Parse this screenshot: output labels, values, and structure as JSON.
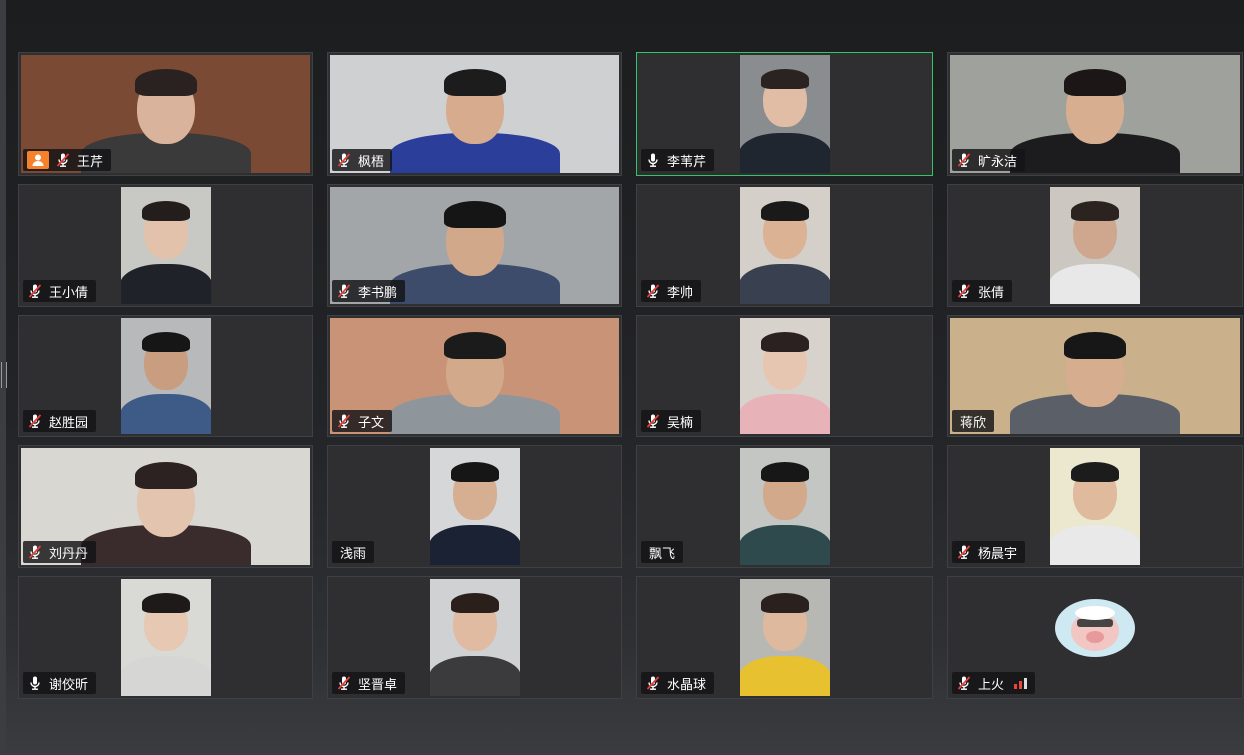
{
  "meeting": {
    "accent_speaking": "#34c56b",
    "host_badge_color": "#f5822a",
    "participants": [
      {
        "name": "王芹",
        "mic": "muted",
        "host": true,
        "speaking": false,
        "video": "full",
        "bg": "#7b4a34",
        "skin": "#d9b39b",
        "hair": "#2a2220",
        "shirt": "#3a3a3a"
      },
      {
        "name": "枫梧",
        "mic": "muted",
        "host": false,
        "speaking": false,
        "video": "full",
        "bg": "#cfd0d2",
        "skin": "#d6ab8e",
        "hair": "#1c1c1c",
        "shirt": "#2b3f9a"
      },
      {
        "name": "李苇芹",
        "mic": "on",
        "host": false,
        "speaking": true,
        "video": "portrait",
        "bg": "#8a8d90",
        "skin": "#e0bda4",
        "hair": "#2a2322",
        "shirt": "#1f2630"
      },
      {
        "name": "旷永洁",
        "mic": "muted",
        "host": false,
        "speaking": false,
        "video": "full",
        "bg": "#9ea19c",
        "skin": "#d7ae90",
        "hair": "#1c1716",
        "shirt": "#1c1c1e"
      },
      {
        "name": "王小倩",
        "mic": "muted",
        "host": false,
        "speaking": false,
        "video": "portrait",
        "bg": "#c8c9c4",
        "skin": "#e2c2ab",
        "hair": "#231d1c",
        "shirt": "#1f2228"
      },
      {
        "name": "李书鹏",
        "mic": "muted",
        "host": false,
        "speaking": false,
        "video": "full",
        "bg": "#a3a6a9",
        "skin": "#d1a88a",
        "hair": "#151515",
        "shirt": "#3c4c6a"
      },
      {
        "name": "李帅",
        "mic": "muted",
        "host": false,
        "speaking": false,
        "video": "portrait",
        "bg": "#d4cfc8",
        "skin": "#dcb295",
        "hair": "#1a1a1a",
        "shirt": "#394150"
      },
      {
        "name": "张倩",
        "mic": "muted",
        "host": false,
        "speaking": false,
        "video": "portrait",
        "bg": "#ccc8c1",
        "skin": "#cfa78e",
        "hair": "#2a2320",
        "shirt": "#e8e8e8"
      },
      {
        "name": "赵胜园",
        "mic": "muted",
        "host": false,
        "speaking": false,
        "video": "portrait",
        "bg": "#b7b9bb",
        "skin": "#c99e80",
        "hair": "#161616",
        "shirt": "#3e5a86"
      },
      {
        "name": "子文",
        "mic": "muted",
        "host": false,
        "speaking": false,
        "video": "full",
        "bg": "#c99377",
        "skin": "#d3a98c",
        "hair": "#1b1b1b",
        "shirt": "#8f969b"
      },
      {
        "name": "吴楠",
        "mic": "muted",
        "host": false,
        "speaking": false,
        "video": "portrait",
        "bg": "#d8d2cc",
        "skin": "#e7c6b1",
        "hair": "#2a2120",
        "shirt": "#e7b3b9"
      },
      {
        "name": "蒋欣",
        "mic": "none",
        "host": false,
        "speaking": false,
        "video": "full",
        "bg": "#cbb08c",
        "skin": "#d6ad8f",
        "hair": "#171717",
        "shirt": "#5b6068"
      },
      {
        "name": "刘丹丹",
        "mic": "muted",
        "host": false,
        "speaking": false,
        "video": "full",
        "bg": "#d9d7d2",
        "skin": "#e3c4ae",
        "hair": "#2b2221",
        "shirt": "#3a2b2d"
      },
      {
        "name": "浅雨",
        "mic": "none",
        "host": false,
        "speaking": false,
        "video": "portrait",
        "bg": "#d6d7d8",
        "skin": "#d6ae92",
        "hair": "#161616",
        "shirt": "#1b2234"
      },
      {
        "name": "飘飞",
        "mic": "none",
        "host": false,
        "speaking": false,
        "video": "portrait",
        "bg": "#c4c6c4",
        "skin": "#d3a98b",
        "hair": "#171717",
        "shirt": "#2e4a4c"
      },
      {
        "name": "杨晨宇",
        "mic": "muted",
        "host": false,
        "speaking": false,
        "video": "portrait",
        "bg": "#ece8cf",
        "skin": "#e0ba9c",
        "hair": "#1c1c1c",
        "shirt": "#e9e9e9"
      },
      {
        "name": "谢佼昕",
        "mic": "on",
        "host": false,
        "speaking": false,
        "video": "portrait",
        "bg": "#d9d9d6",
        "skin": "#e6c8b3",
        "hair": "#1e1a19",
        "shirt": "#d6d6d4"
      },
      {
        "name": "坚晋卓",
        "mic": "muted",
        "host": false,
        "speaking": false,
        "video": "portrait",
        "bg": "#cfd1d3",
        "skin": "#e0bba2",
        "hair": "#2b1f1c",
        "shirt": "#3b3b3d"
      },
      {
        "name": "水晶球",
        "mic": "muted",
        "host": false,
        "speaking": false,
        "video": "portrait",
        "bg": "#b7b8b4",
        "skin": "#dfb99e",
        "hair": "#2a211e",
        "shirt": "#e7c12f"
      },
      {
        "name": "上火",
        "mic": "muted",
        "host": false,
        "speaking": false,
        "video": "avatar",
        "bg": "#2f2f31",
        "skin": "",
        "hair": "",
        "shirt": "",
        "signal": true
      }
    ]
  }
}
